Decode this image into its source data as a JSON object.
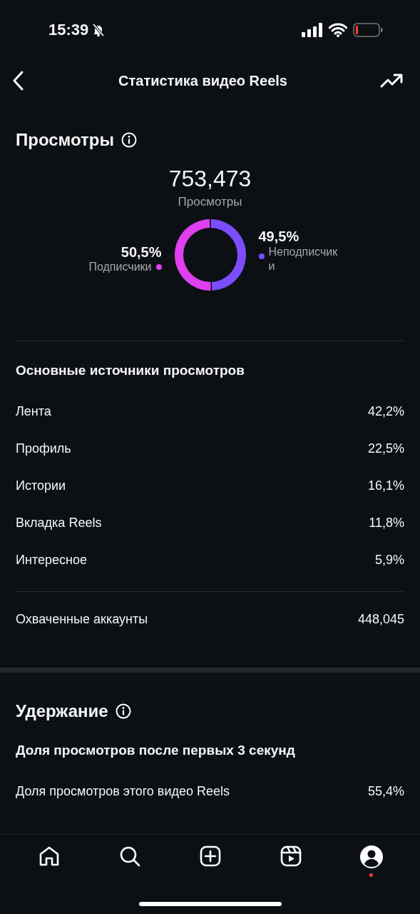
{
  "status_bar": {
    "time": "15:39"
  },
  "header": {
    "title": "Статистика видео Reels"
  },
  "views": {
    "title": "Просмотры",
    "total": "753,473",
    "total_label": "Просмотры",
    "legend": [
      {
        "value": "50,5%",
        "color": "#e040f0"
      },
      {
        "value": "49,5%",
        "color": "#7c4dff"
      }
    ],
    "chart_data": {
      "type": "donut",
      "categories": [
        "Подписчики",
        "Неподписчики"
      ],
      "values": [
        50.5,
        49.5
      ]
    },
    "sources_title": "Основные источники просмотров",
    "sources": [
      {
        "label": "Лента",
        "value": "42,2%"
      },
      {
        "label": "Профиль",
        "value": "22,5%"
      },
      {
        "label": "Истории",
        "value": "16,1%"
      },
      {
        "label": "Вкладка Reels",
        "value": "11,8%"
      },
      {
        "label": "Интересное",
        "value": "5,9%"
      }
    ],
    "reach": {
      "label": "Охваченные аккаунты",
      "value": "448,045"
    }
  },
  "retention": {
    "title": "Удержание",
    "subtitle": "Доля просмотров после первых 3 секунд",
    "rows": [
      {
        "label": "Доля просмотров этого видео Reels",
        "value": "55,4%"
      }
    ]
  },
  "tab_bar": [
    {
      "kind": "home",
      "dot": false
    },
    {
      "kind": "search",
      "dot": false
    },
    {
      "kind": "create",
      "dot": false
    },
    {
      "kind": "reels",
      "dot": false
    },
    {
      "kind": "profile",
      "dot": true
    }
  ]
}
